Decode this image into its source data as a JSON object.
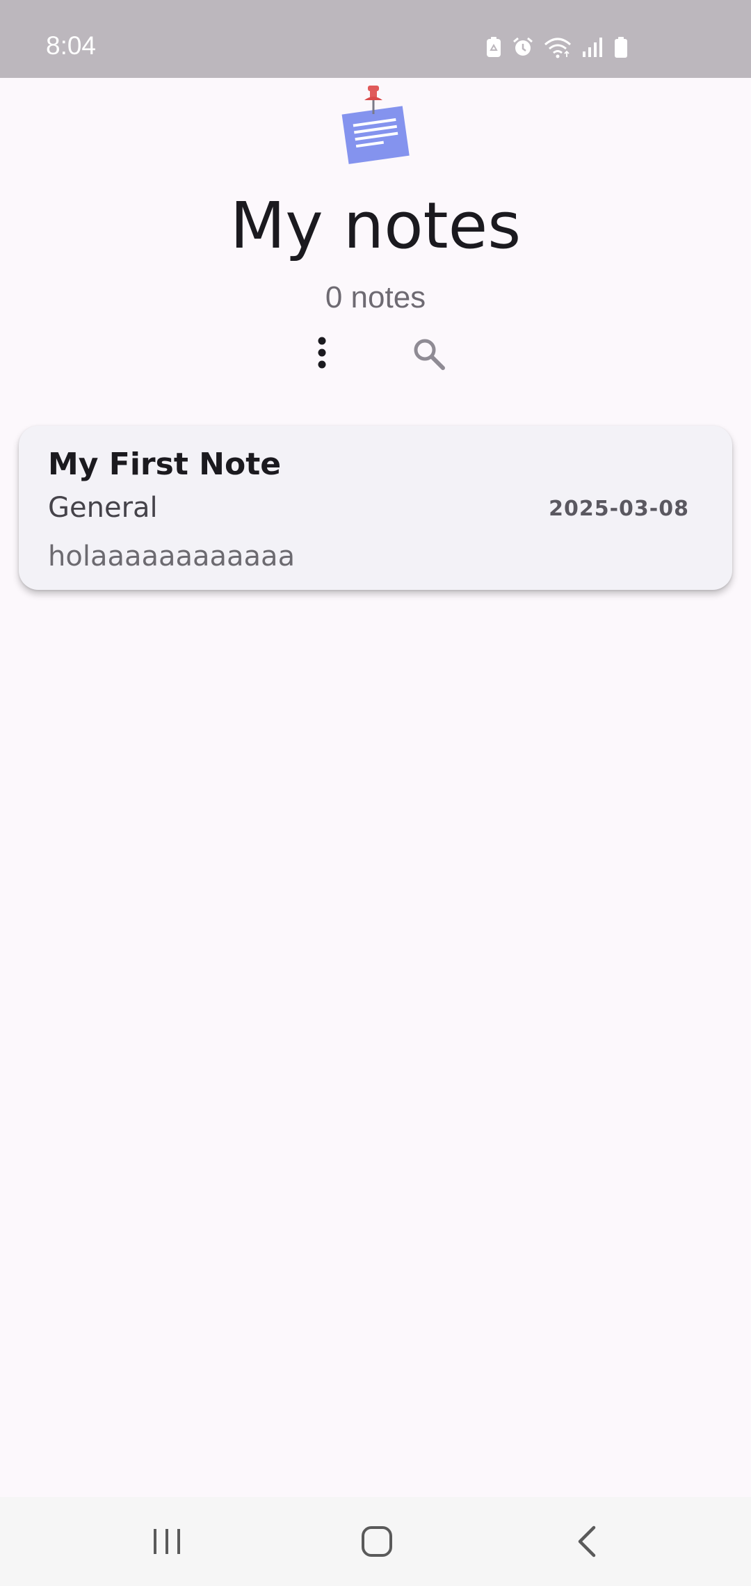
{
  "status_bar": {
    "time": "8:04",
    "icons": [
      "battery-saver-icon",
      "alarm-icon",
      "wifi-icon",
      "signal-icon",
      "battery-icon"
    ]
  },
  "header": {
    "logo_icon": "pinned-note-icon",
    "title": "My notes",
    "count": "0 notes",
    "more_icon": "more-vert-icon",
    "search_icon": "search-icon"
  },
  "notes": [
    {
      "title": "My First Note",
      "category": "General",
      "date": "2025-03-08",
      "body": "holaaaaaaaaaaaa"
    }
  ],
  "nav_bar": {
    "icons": [
      "recents-icon",
      "home-icon",
      "back-icon"
    ]
  },
  "colors": {
    "background": "#fcf8fc",
    "status_bar": "#bcb7bd",
    "card": "#f3f2f7",
    "note_paper": "#8493ee",
    "pin": "#e05a5a"
  }
}
